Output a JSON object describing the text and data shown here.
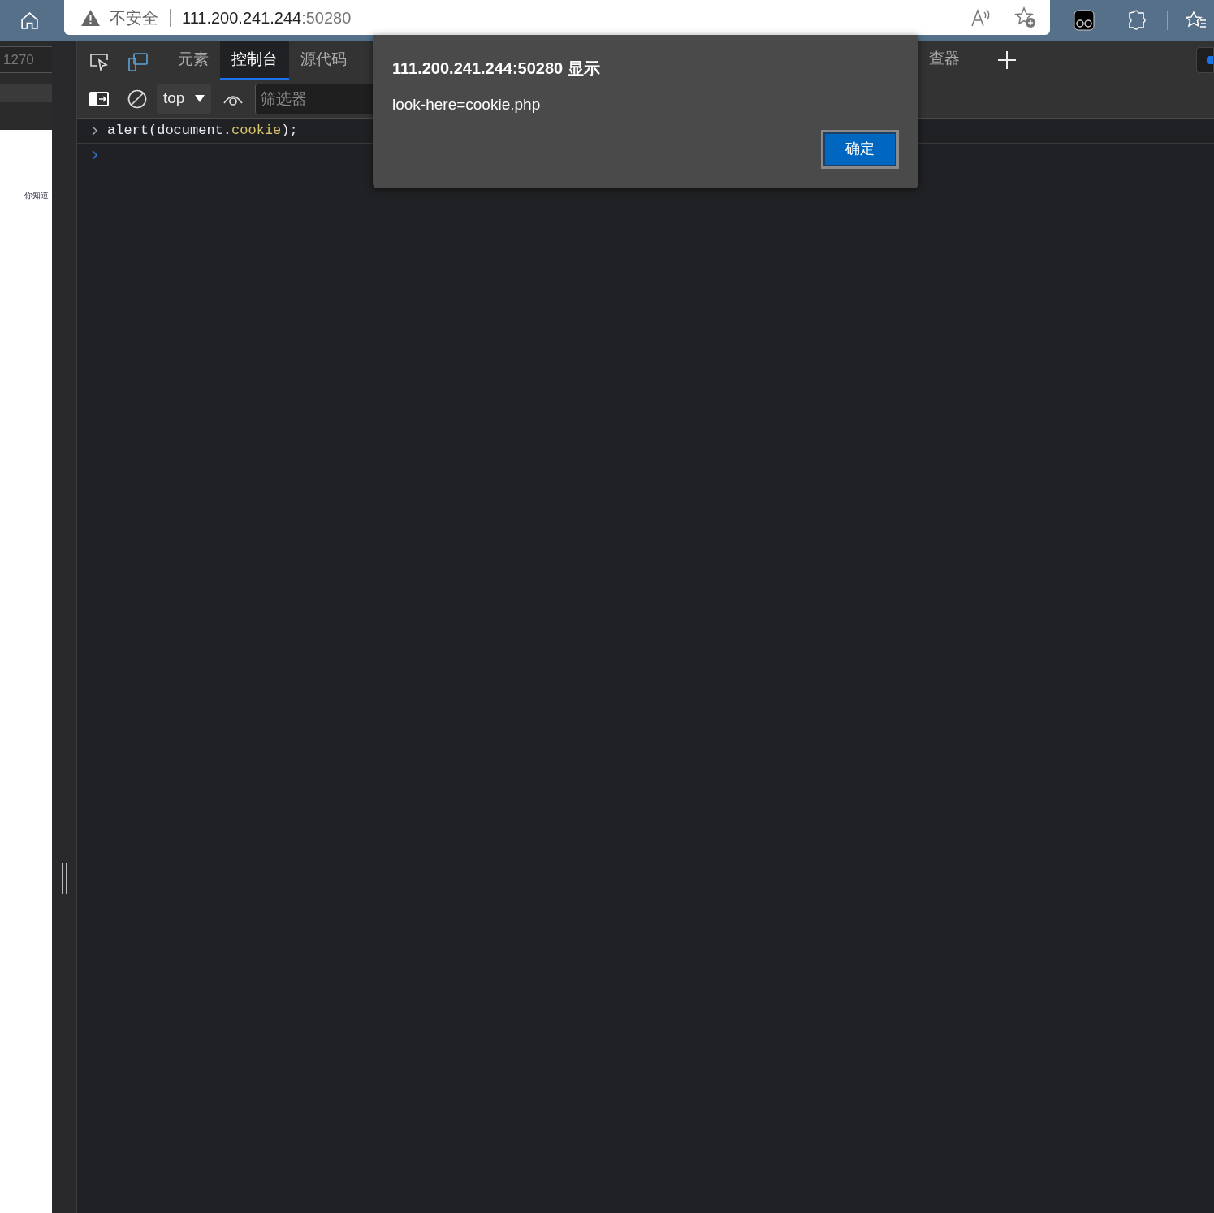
{
  "browser": {
    "security_label": "不安全",
    "url_host": "111.200.241.244",
    "url_port": ":50280"
  },
  "left_pane": {
    "width_value": "1270",
    "page_text": "你知道"
  },
  "devtools": {
    "tabs": [
      {
        "label": "元素",
        "selected": false
      },
      {
        "label": "控制台",
        "selected": true
      },
      {
        "label": "源代码",
        "selected": false
      }
    ],
    "cut_tab": "查器",
    "toolbar": {
      "context": "top",
      "filter_placeholder": "筛选器"
    },
    "console": {
      "entries": [
        {
          "segments": [
            {
              "text": "alert(document.",
              "kind": "plain"
            },
            {
              "text": "cookie",
              "kind": "property"
            },
            {
              "text": ");",
              "kind": "plain"
            }
          ]
        }
      ]
    }
  },
  "dialog": {
    "title": "111.200.241.244:50280 显示",
    "message": "look-here=cookie.php",
    "button": "确定"
  }
}
